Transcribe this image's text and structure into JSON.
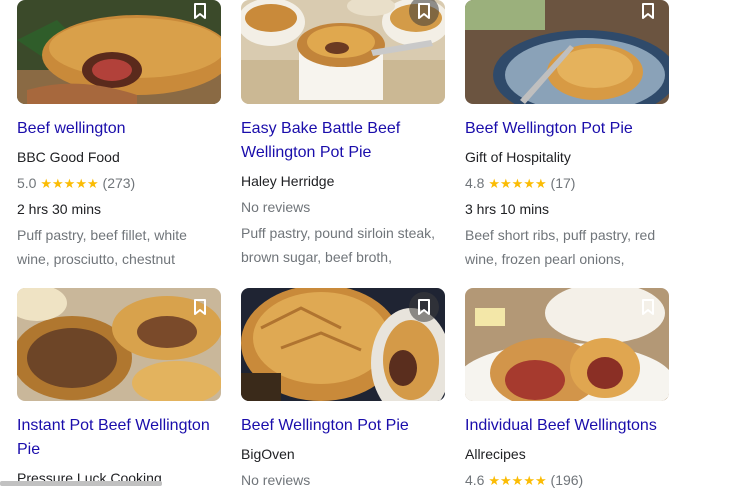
{
  "row1": [
    {
      "title": "Beef wellington",
      "source": "BBC Good Food",
      "rating": "5.0",
      "stars": "★★★★★",
      "reviews": "(273)",
      "duration": "2 hrs 30 mins",
      "ingredients": "Puff pastry, beef fillet, white wine, prosciutto, chestnut"
    },
    {
      "title": "Easy Bake Battle Beef Wellington Pot Pie",
      "source": "Haley Herridge",
      "no_reviews": "No reviews",
      "ingredients": "Puff pastry, pound sirloin steak, brown sugar, beef broth,"
    },
    {
      "title": "Beef Wellington Pot Pie",
      "source": "Gift of Hospitality",
      "rating": "4.8",
      "stars": "★★★★★",
      "reviews": "(17)",
      "duration": "3 hrs 10 mins",
      "ingredients": "Beef short ribs, puff pastry, red wine, frozen pearl onions,"
    }
  ],
  "row2": [
    {
      "title": "Instant Pot Beef Wellington Pie",
      "source": "Pressure Luck Cooking"
    },
    {
      "title": "Beef Wellington Pot Pie",
      "source": "BigOven",
      "no_reviews": "No reviews"
    },
    {
      "title": "Individual Beef Wellingtons",
      "source": "Allrecipes",
      "rating": "4.6",
      "stars": "★★★★★",
      "reviews": "(196)"
    }
  ],
  "icons": {
    "save": "bookmark-icon"
  },
  "colors": {
    "link": "#1a0dab",
    "star": "#fbbc04",
    "muted": "#70757a",
    "text": "#202124"
  }
}
